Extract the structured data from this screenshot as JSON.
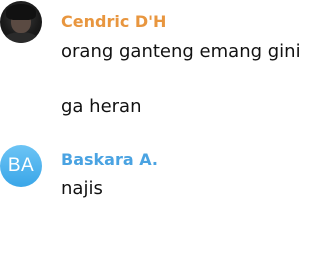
{
  "messages": [
    {
      "sender": "Cendric D'H",
      "avatar": {
        "type": "photo",
        "icon": "user-photo-avatar"
      },
      "lines": [
        "orang ganteng emang gini",
        "ga heran"
      ]
    },
    {
      "sender": "Baskara A.",
      "avatar": {
        "type": "initials",
        "initials": "BA",
        "color": "#4aa9ea"
      },
      "lines": [
        "najis"
      ]
    }
  ],
  "colors": {
    "sender_1": "#e8963f",
    "sender_2": "#4aa3e2",
    "text": "#111111"
  }
}
